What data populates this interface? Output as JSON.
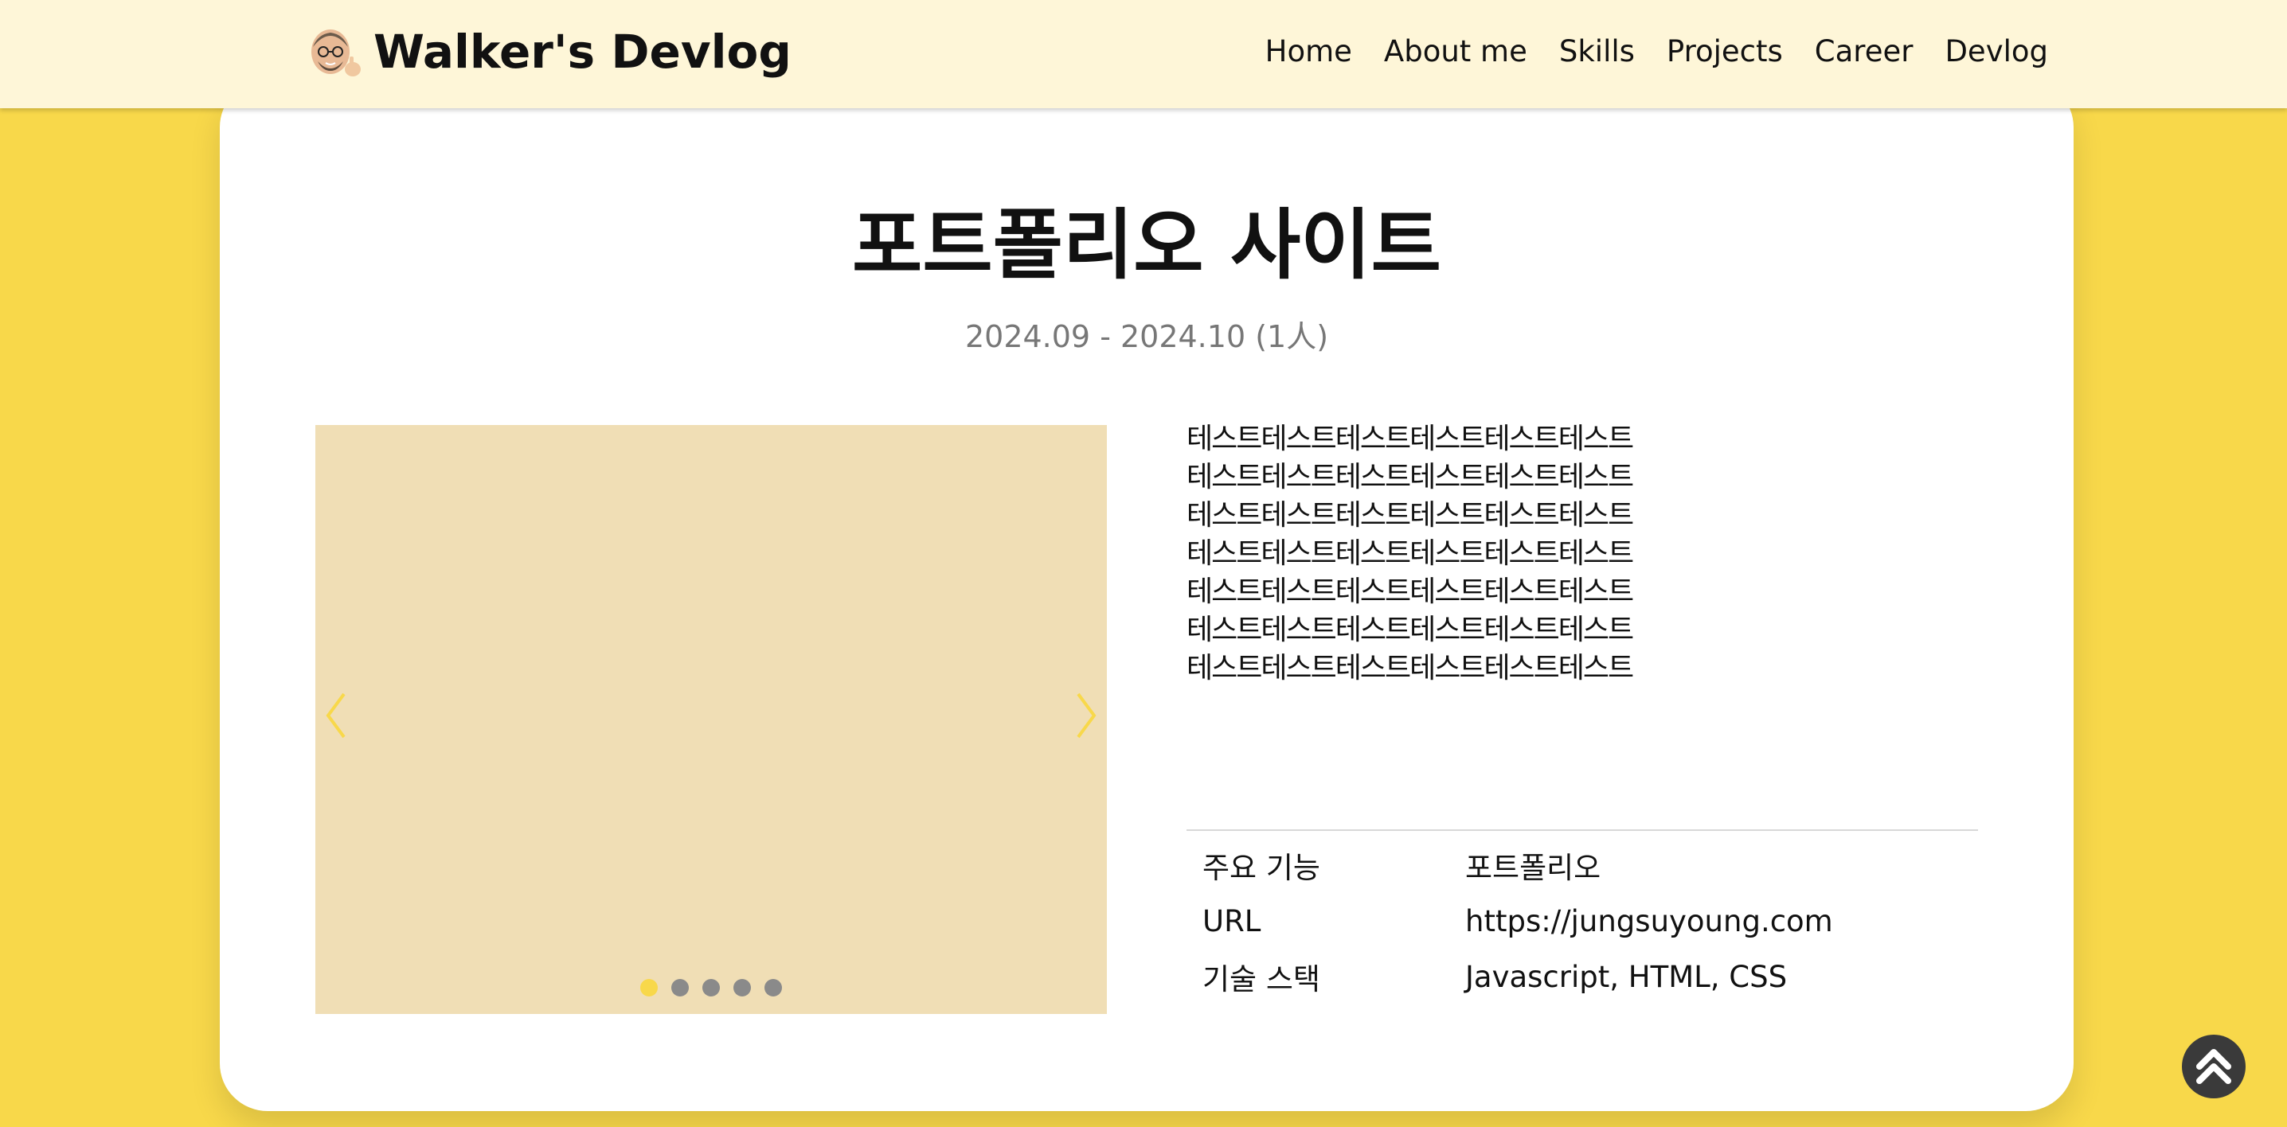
{
  "header": {
    "brand": "Walker's Devlog",
    "nav": [
      "Home",
      "About me",
      "Skills",
      "Projects",
      "Career",
      "Devlog"
    ]
  },
  "project": {
    "title": "포트폴리오 사이트",
    "period": "2024.09 - 2024.10 (1人)",
    "description_lines": [
      "테스트테스트테스트테스트테스트테스트",
      "테스트테스트테스트테스트테스트테스트",
      "테스트테스트테스트테스트테스트테스트",
      "테스트테스트테스트테스트테스트테스트",
      "테스트테스트테스트테스트테스트테스트",
      "테스트테스트테스트테스트테스트테스트",
      "테스트테스트테스트테스트테스트테스트"
    ],
    "details": [
      {
        "label": "주요 기능",
        "value": "포트폴리오"
      },
      {
        "label": "URL",
        "value": "https://jungsuyoung.com"
      },
      {
        "label": "기술 스택",
        "value": "Javascript, HTML, CSS"
      }
    ]
  },
  "slider": {
    "slide_count": 5,
    "active_index": 0,
    "prev_icon": "chevron-left-icon",
    "next_icon": "chevron-right-icon"
  },
  "scroll_top_icon": "double-chevron-up-icon",
  "colors": {
    "background": "#f8d84a",
    "header": "#fef6d8",
    "slide": "#f0deb5",
    "accent": "#f8d84a",
    "dot_inactive": "#8a8a8a",
    "muted_text": "#777777"
  }
}
